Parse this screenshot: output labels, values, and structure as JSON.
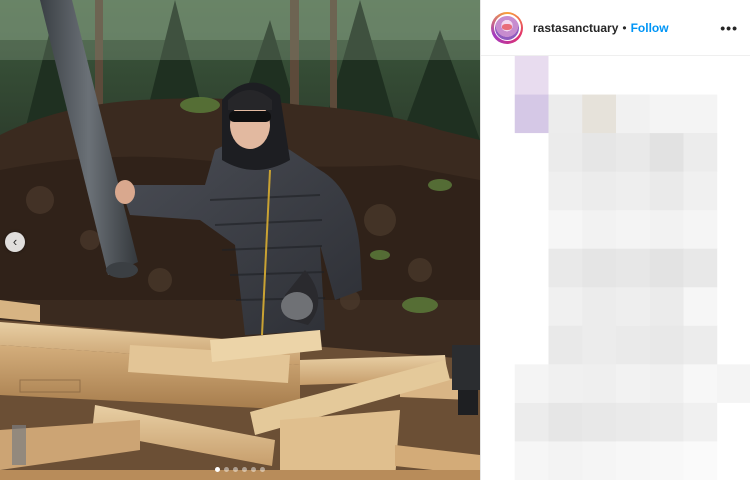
{
  "post": {
    "username": "rastasanctuary",
    "separator": "•",
    "follow_label": "Follow",
    "more_label": "•••"
  },
  "carousel": {
    "prev_label": "‹",
    "dot_count": 6,
    "active_index": 0
  },
  "icons": {
    "avatar": "profile-avatar",
    "prev": "chevron-left-icon",
    "more": "more-options-icon"
  },
  "colors": {
    "follow": "#0095f6",
    "text": "#262626",
    "divider": "#efefef"
  },
  "blurred_pixels": [
    [
      "#ffffff",
      "#e8dcef",
      "#ffffff",
      "#ffffff",
      "#ffffff",
      "#ffffff",
      "#ffffff",
      "#ffffff"
    ],
    [
      "#ffffff",
      "#d5c8e6",
      "#ececec",
      "#e6e2da",
      "#f1f1f1",
      "#f4f4f4",
      "#f4f4f4",
      "#ffffff"
    ],
    [
      "#ffffff",
      "#ffffff",
      "#ebebeb",
      "#e6e6e6",
      "#e9e9e9",
      "#e2e2e2",
      "#ececec",
      "#ffffff"
    ],
    [
      "#ffffff",
      "#ffffff",
      "#efefef",
      "#ececec",
      "#eeeeee",
      "#eaeaea",
      "#f0f0f0",
      "#ffffff"
    ],
    [
      "#ffffff",
      "#ffffff",
      "#f6f6f6",
      "#f2f2f2",
      "#f4f4f4",
      "#f2f2f2",
      "#f5f5f5",
      "#ffffff"
    ],
    [
      "#ffffff",
      "#ffffff",
      "#e9e9e9",
      "#e5e5e5",
      "#e7e7e7",
      "#e3e3e3",
      "#e8e8e8",
      "#ffffff"
    ],
    [
      "#ffffff",
      "#ffffff",
      "#f0f0f0",
      "#ececec",
      "#eeeeee",
      "#ebebeb",
      "#f6f6f6",
      "#ffffff"
    ],
    [
      "#ffffff",
      "#ffffff",
      "#e9e9e9",
      "#ececec",
      "#eaeaea",
      "#e8e8e8",
      "#ececec",
      "#ffffff"
    ],
    [
      "#ffffff",
      "#f4f4f4",
      "#f0f0f0",
      "#efefef",
      "#f2f2f2",
      "#f0f0f0",
      "#f7f7f7",
      "#f4f4f4"
    ],
    [
      "#ffffff",
      "#ececec",
      "#e6e6e6",
      "#e8e8e8",
      "#eaeaea",
      "#ebebeb",
      "#f0f0f0",
      "#ffffff"
    ],
    [
      "#ffffff",
      "#f6f6f6",
      "#f3f3f3",
      "#f5f5f5",
      "#f7f7f7",
      "#f8f8f8",
      "#fafafa",
      "#ffffff"
    ]
  ]
}
